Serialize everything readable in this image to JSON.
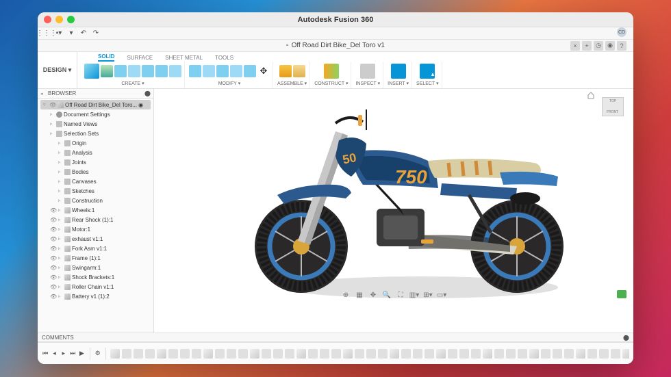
{
  "window": {
    "title": "Autodesk Fusion 360"
  },
  "document": {
    "tab_label": "Off Road Dirt Bike_Del Toro v1"
  },
  "user_badge": "CD",
  "design_button": "DESIGN ▾",
  "ribbon_tabs": [
    "SOLID",
    "SURFACE",
    "SHEET METAL",
    "TOOLS"
  ],
  "ribbon_groups": [
    {
      "label": "CREATE ▾"
    },
    {
      "label": "MODIFY ▾"
    },
    {
      "label": "ASSEMBLE ▾"
    },
    {
      "label": "CONSTRUCT ▾"
    },
    {
      "label": "INSPECT ▾"
    },
    {
      "label": "INSERT ▾"
    },
    {
      "label": "SELECT ▾"
    }
  ],
  "browser": {
    "header": "BROWSER",
    "root": "Off Road Dirt Bike_Del Toro...",
    "items": [
      {
        "label": "Document Settings",
        "icon": "gear",
        "lvl": 1
      },
      {
        "label": "Named Views",
        "icon": "folder",
        "lvl": 1
      },
      {
        "label": "Selection Sets",
        "icon": "folder",
        "lvl": 1
      },
      {
        "label": "Origin",
        "icon": "folder",
        "lvl": 2
      },
      {
        "label": "Analysis",
        "icon": "folder",
        "lvl": 2
      },
      {
        "label": "Joints",
        "icon": "folder",
        "lvl": 2
      },
      {
        "label": "Bodies",
        "icon": "folder",
        "lvl": 2
      },
      {
        "label": "Canvases",
        "icon": "folder",
        "lvl": 2
      },
      {
        "label": "Sketches",
        "icon": "folder",
        "lvl": 2
      },
      {
        "label": "Construction",
        "icon": "folder",
        "lvl": 2
      }
    ],
    "components": [
      {
        "label": "Wheels:1"
      },
      {
        "label": "Rear Shock (1):1"
      },
      {
        "label": "Motor:1"
      },
      {
        "label": "exhaust v1:1"
      },
      {
        "label": "Fork Asm v1:1"
      },
      {
        "label": "Frame (1):1"
      },
      {
        "label": "Swingarm:1"
      },
      {
        "label": "Shock Brackets:1"
      },
      {
        "label": "Roller Chain v1:1"
      },
      {
        "label": "Battery v1 (1):2"
      }
    ]
  },
  "comments_label": "COMMENTS",
  "viewcube": {
    "top": "TOP",
    "front": "FRONT"
  },
  "bike_number": "750"
}
